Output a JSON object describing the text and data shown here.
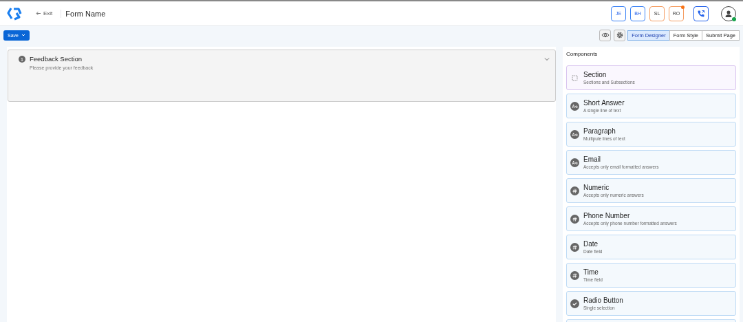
{
  "header": {
    "exit": "Exit",
    "title": "Form Name",
    "users": [
      {
        "initials": "JE",
        "color": "#3b82f6",
        "notification": false
      },
      {
        "initials": "BH",
        "color": "#3b82f6",
        "notification": false
      },
      {
        "initials": "SL",
        "color": "#f59e63",
        "notification": false
      },
      {
        "initials": "RO",
        "color": "#f59e63",
        "notification": true
      }
    ],
    "profile_online": true
  },
  "toolbar": {
    "save": "Save",
    "tabs": [
      {
        "label": "Form Designer",
        "selected": true
      },
      {
        "label": "Form Style",
        "selected": false
      },
      {
        "label": "Submit Page",
        "selected": false
      }
    ]
  },
  "section": {
    "number": "1",
    "title": "Feedback Section",
    "subtitle": "Please provide your feedback",
    "expanded": true
  },
  "components": {
    "title": "Components",
    "items": [
      {
        "kind": "section",
        "name": "Section",
        "description": "Sections and Subsections"
      },
      {
        "kind": "text",
        "name": "Short Answer",
        "description": "A single line of text"
      },
      {
        "kind": "text",
        "name": "Paragraph",
        "description": "Multipule lines of text"
      },
      {
        "kind": "text",
        "name": "Email",
        "description": "Accepts only email formatted answers"
      },
      {
        "kind": "number",
        "name": "Numeric",
        "description": "Accepts only numeric answers"
      },
      {
        "kind": "number",
        "name": "Phone Number",
        "description": "Accepts only phone number formatted answers"
      },
      {
        "kind": "number",
        "name": "Date",
        "description": "Date field"
      },
      {
        "kind": "number",
        "name": "Time",
        "description": "Time field"
      },
      {
        "kind": "check",
        "name": "Radio Button",
        "description": "Single selection"
      }
    ]
  }
}
